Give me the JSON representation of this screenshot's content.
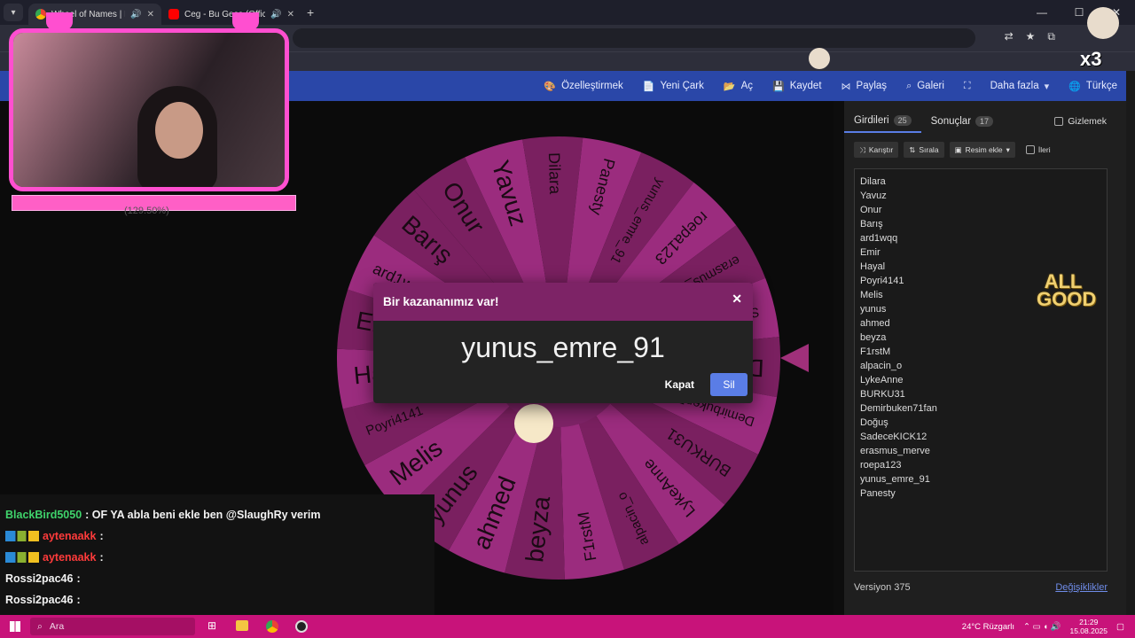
{
  "browser": {
    "tabs": [
      {
        "title": "Wheel of Names | Rastgele",
        "active": true
      },
      {
        "title": "Ceg - Bu Gece (Official Vide",
        "active": false
      }
    ]
  },
  "nav": {
    "customize": "Özelleştirmek",
    "new_wheel": "Yeni Çark",
    "open": "Aç",
    "save": "Kaydet",
    "share": "Paylaş",
    "gallery": "Galeri",
    "more": "Daha fazla",
    "language": "Türkçe"
  },
  "modal": {
    "title": "Bir kazananımız var!",
    "winner": "yunus_emre_91",
    "close_label": "Kapat",
    "remove_label": "Sil"
  },
  "panel": {
    "entries_tab": "Girdileri",
    "entries_count": "25",
    "results_tab": "Sonuçlar",
    "results_count": "17",
    "hide_label": "Gizlemek",
    "shuffle": "Karıştır",
    "sort": "Sırala",
    "add_image": "Resim ekle",
    "advanced": "İleri",
    "entries": [
      "Dilara",
      "Yavuz",
      "Onur",
      "Barış",
      "ard1wqq",
      "Emir",
      "Hayal",
      "Poyri4141",
      "Melis",
      "yunus",
      "ahmed",
      "beyza",
      "F1rstM",
      "alpacin_o",
      "LykeAnne",
      "BURKU31",
      "Demirbuken71fan",
      "Doğuş",
      "SadeceKICK12",
      "erasmus_merve",
      "roepa123",
      "yunus_emre_91",
      "Panesty"
    ],
    "version": "Versiyon 375",
    "changes": "Değişiklikler"
  },
  "wheel": {
    "segments": [
      "Onur",
      "Yavuz",
      "Dilara",
      "Panesty",
      "yunus_emre_91",
      "roepa123",
      "erasmus_merve",
      "SadeceKICK12",
      "Doğuş",
      "Demirbuken71fan",
      "BURKU31",
      "LykeAnne",
      "alpacin_o",
      "F1rstM",
      "beyza",
      "ahmed",
      "yunus",
      "Melis",
      "Poyri4141",
      "Hayal",
      "Emir",
      "ard1wqq",
      "Barış"
    ],
    "colors": [
      "#7a2060",
      "#9b2c7e"
    ]
  },
  "overlay": {
    "stats": "(129.50%)",
    "allgood": "ALL GOOD",
    "multiplier": "x3"
  },
  "chat": [
    {
      "user": "BlackBird5050",
      "color": "#3fd36b",
      "msg": ": OF YA abla beni ekle ben @SlaughRy verim"
    },
    {
      "user": "aytenaakk",
      "color": "#ff3b3b",
      "msg": ":"
    },
    {
      "user": "aytenaakk",
      "color": "#ff3b3b",
      "msg": ":"
    },
    {
      "user": "Rossi2pac46",
      "color": "#f2f2f2",
      "msg": ":"
    },
    {
      "user": "Rossi2pac46",
      "color": "#f2f2f2",
      "msg": ":"
    }
  ],
  "taskbar": {
    "search_placeholder": "Ara",
    "weather": "24°C  Rüzgarlı",
    "time": "21:29",
    "date": "15.08.2025"
  }
}
